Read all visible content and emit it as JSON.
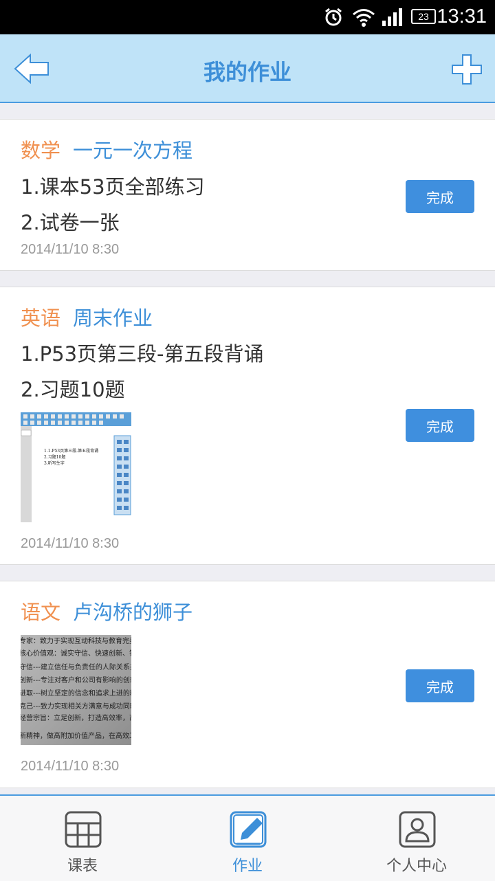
{
  "status_bar": {
    "time": "13:31",
    "battery": "23"
  },
  "header": {
    "title": "我的作业"
  },
  "assignments": [
    {
      "subject": "数学",
      "topic": "一元一次方程",
      "lines": [
        "1.课本53页全部练习",
        "2.试卷一张"
      ],
      "date": "2014/11/10  8:30",
      "button": "完成"
    },
    {
      "subject": "英语",
      "topic": "周末作业",
      "lines": [
        "1.P53页第三段-第五段背诵",
        "2.习题10题"
      ],
      "date": "2014/11/10  8:30",
      "button": "完成",
      "image_text": [
        "1.1.P53页第三段-第五段背诵",
        "2.习题10题",
        "3.听写生字"
      ]
    },
    {
      "subject": "语文",
      "topic": "卢沟桥的狮子",
      "lines": [],
      "date": "2014/11/10  8:30",
      "button": "完成",
      "image_text": [
        "专家：致力于实现互动科技与教育完美结合",
        "核心价值观：诚实守信、快速创新、锐意进",
        "守信---建立信任与负责任的人际关系并基",
        "创新---专注对客户和公司有影响的创新并",
        "进取---树立坚定的信念和追求上进的精神",
        "克己---致力实现相关方满意与成功同时实",
        "经营宗旨：立足创新，打造高效率，高收",
        "新精神，做高附加价值产品，在高效工作"
      ]
    }
  ],
  "tabs": [
    {
      "label": "课表",
      "icon": "timetable-icon"
    },
    {
      "label": "作业",
      "icon": "homework-icon"
    },
    {
      "label": "个人中心",
      "icon": "profile-icon"
    }
  ],
  "colors": {
    "header_bg": "#bfe3f8",
    "accent": "#3d8fd8",
    "subject": "#f0904f",
    "button": "#3f8fde"
  }
}
